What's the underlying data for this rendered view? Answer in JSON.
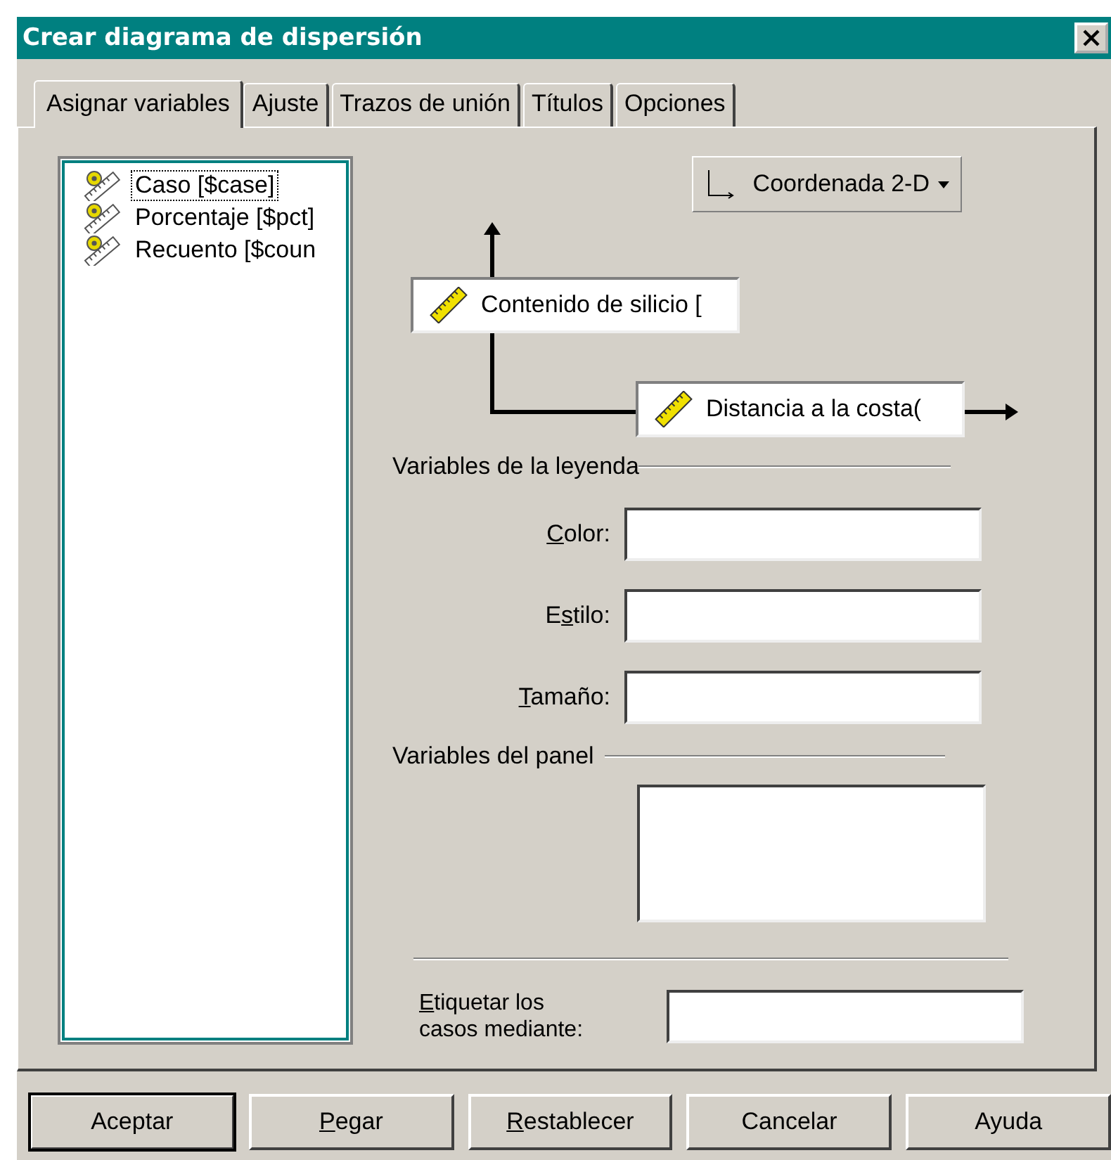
{
  "window": {
    "title": "Crear diagrama de dispersión"
  },
  "tabs": [
    {
      "label": "Asignar variables",
      "selected": true
    },
    {
      "label": "Ajuste",
      "selected": false
    },
    {
      "label": "Trazos de unión",
      "selected": false
    },
    {
      "label": "Títulos",
      "selected": false
    },
    {
      "label": "Opciones",
      "selected": false
    }
  ],
  "variables": [
    {
      "label": "Caso [$case]",
      "selected": true
    },
    {
      "label": "Porcentaje [$pct]",
      "selected": false
    },
    {
      "label": "Recuento [$coun",
      "selected": false
    }
  ],
  "coordinate_button": {
    "label": "Coordenada 2-D"
  },
  "y_axis": {
    "label": "Contenido de silicio ["
  },
  "x_axis": {
    "label": "Distancia a la costa("
  },
  "legend": {
    "title": "Variables de la leyenda",
    "fields": [
      {
        "key": "C",
        "post": "olor:"
      },
      {
        "pre": "E",
        "key": "s",
        "post": "tilo:"
      },
      {
        "key": "T",
        "post": "amaño:"
      }
    ]
  },
  "panel": {
    "title": "Variables del panel"
  },
  "label_cases": {
    "key": "E",
    "post": "tiquetar los casos mediante:"
  },
  "buttons": [
    {
      "post": "Aceptar",
      "default": true
    },
    {
      "key": "P",
      "post": "egar",
      "default": false
    },
    {
      "key": "R",
      "post": "establecer",
      "default": false
    },
    {
      "post": "Cancelar",
      "default": false
    },
    {
      "post": "Ayuda",
      "default": false
    }
  ]
}
